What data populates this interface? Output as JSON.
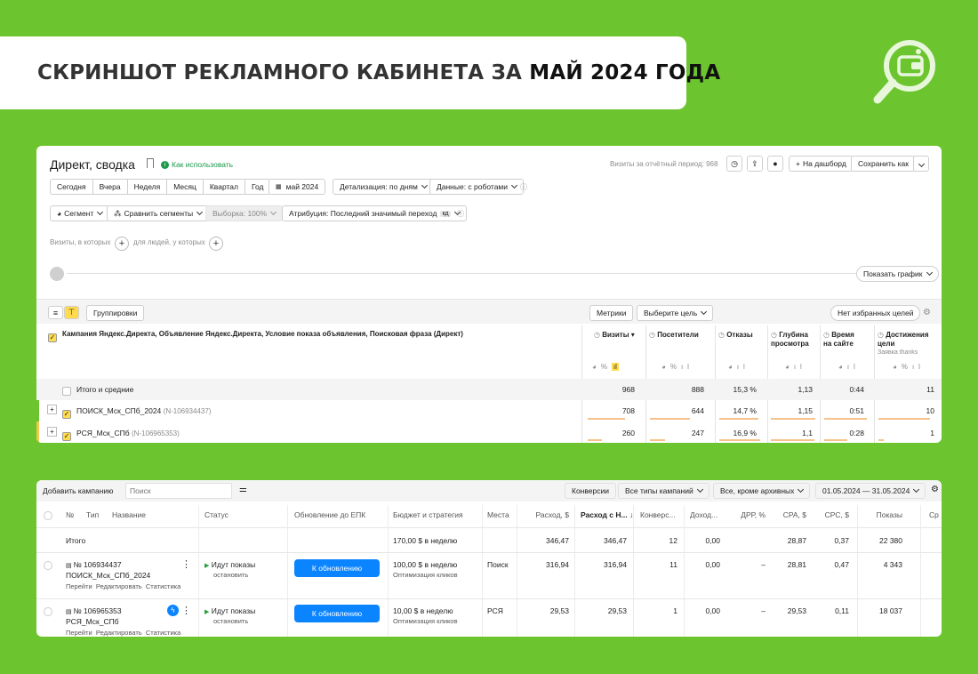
{
  "banner": {
    "text_regular": "СКРИНШОТ РЕКЛАМНОГО КАБИНЕТА ЗА ",
    "text_bold": "МАЙ 2024 ГОДА"
  },
  "colors": {
    "background": "#6cc52e",
    "accent_yellow": "#ffdb4d",
    "blue_button": "#0a84ff",
    "progress_bar": "#f6c28a"
  },
  "report": {
    "title": "Директ, сводка",
    "how_to_use": "Как использовать",
    "visits_period": "Визиты за отчётный период: 968",
    "add_dashboard": "На дашборд",
    "save_as": "Сохранить как",
    "periods": [
      "Сегодня",
      "Вчера",
      "Неделя",
      "Месяц",
      "Квартал",
      "Год"
    ],
    "date": "май 2024",
    "detail": "Детализация: по дням",
    "data_filter": "Данные: с роботами",
    "segment": "Сегмент",
    "compare": "Сравнить сегменты",
    "sample": "Выборка: 100%",
    "attribution": "Атрибуция: Последний значимый переход",
    "attribution_badge": "кд",
    "visits_which": "Визиты, в которых",
    "people_which": "для людей, у которых",
    "show_chart": "Показать график",
    "groupings": "Группировки",
    "metrics": "Метрики",
    "choose_goal": "Выберите цель",
    "no_fav_goals": "Нет избранных целей",
    "dimension_header": "Кампания Яндекс.Директа, Объявление Яндекс.Директа, Условие показа объявления, Поисковая фраза (Директ)",
    "metric_headers": [
      {
        "label": "Визиты",
        "sub": ""
      },
      {
        "label": "Посетители",
        "sub": ""
      },
      {
        "label": "Отказы",
        "sub": ""
      },
      {
        "label": "Глубина просмотра",
        "sub": ""
      },
      {
        "label": "Время на сайте",
        "sub": ""
      },
      {
        "label": "Достижения цели",
        "sub": "Заявка thanks"
      }
    ],
    "totals": {
      "label": "Итого и средние",
      "values": [
        "968",
        "888",
        "15,3 %",
        "1,13",
        "0:44",
        "11"
      ]
    },
    "rows": [
      {
        "name": "ПОИСК_Мск_СПб_2024",
        "id": "(N-106934437)",
        "values": [
          "708",
          "644",
          "14,7 %",
          "1,15",
          "0:51",
          "10"
        ],
        "bar_fractions": [
          0.73,
          0.73,
          0.96,
          1.0,
          1.0,
          0.91
        ]
      },
      {
        "name": "РСЯ_Мск_СПб",
        "id": "(N-106965353)",
        "values": [
          "260",
          "247",
          "16,9 %",
          "1,1",
          "0:28",
          "1"
        ],
        "bar_fractions": [
          0.27,
          0.28,
          1.0,
          0.97,
          0.55,
          0.09
        ]
      }
    ]
  },
  "campaigns": {
    "add_campaign": "Добавить кампанию",
    "search_placeholder": "Поиск",
    "conversions": "Конверсии",
    "all_types": "Все типы кампаний",
    "all_except_archived": "Все, кроме архивных",
    "date_range": "01.05.2024 — 31.05.2024",
    "headers": [
      "№",
      "Тип",
      "Название",
      "Статус",
      "Обновление до ЕПК",
      "Бюджет и стратегия",
      "Места",
      "Расход, $",
      "Расход с Н...",
      "Конверс...",
      "Доход...",
      "ДРР, %",
      "CPA, $",
      "CPC, $",
      "Показы",
      "Ср"
    ],
    "total": {
      "label": "Итого",
      "budget": "170,00 $ в неделю",
      "spend": "346,47",
      "spend_vat": "346,47",
      "conv": "12",
      "income": "0,00",
      "cpa": "28,87",
      "cpc": "0,37",
      "impressions": "22 380"
    },
    "rows": [
      {
        "num": "№ 106934437",
        "name": "ПОИСК_Мск_СПб_2024",
        "links": [
          "Перейти",
          "Редактировать",
          "Статистика"
        ],
        "status": "Идут показы",
        "stop": "остановить",
        "update": "К обновлению",
        "budget": "100,00 $ в неделю",
        "strategy": "Оптимизация кликов",
        "place": "Поиск",
        "spend": "316,94",
        "spend_vat": "316,94",
        "conv": "11",
        "income": "0,00",
        "drr": "–",
        "cpa": "28,81",
        "cpc": "0,47",
        "impressions": "4 343"
      },
      {
        "num": "№ 106965353",
        "name": "РСЯ_Мск_СПб",
        "links": [
          "Перейти",
          "Редактировать",
          "Статистика"
        ],
        "status": "Идут показы",
        "stop": "остановить",
        "update": "К обновлению",
        "budget": "10,00 $ в неделю",
        "strategy": "Оптимизация кликов",
        "place": "РСЯ",
        "spend": "29,53",
        "spend_vat": "29,53",
        "conv": "1",
        "income": "0,00",
        "drr": "–",
        "cpa": "29,53",
        "cpc": "0,11",
        "impressions": "18 037"
      }
    ]
  }
}
